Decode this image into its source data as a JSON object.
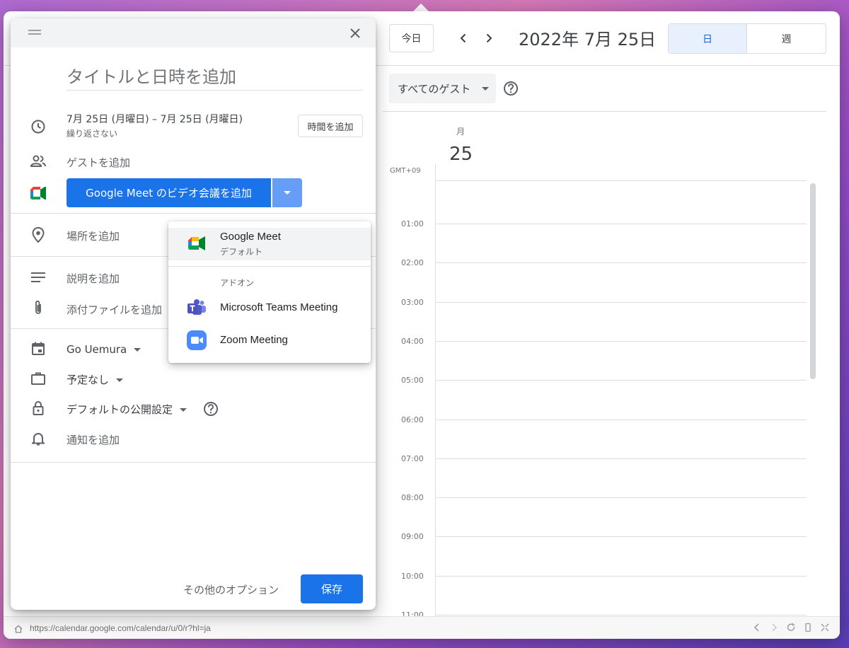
{
  "calendar": {
    "today_label": "今日",
    "date_title": "2022年 7月 25日",
    "views": {
      "day": "日",
      "week": "週"
    },
    "guest_filter": "すべてのゲスト",
    "day_name": "月",
    "day_number": "25",
    "timezone": "GMT+09",
    "hours": [
      "01:00",
      "02:00",
      "03:00",
      "04:00",
      "05:00",
      "06:00",
      "07:00",
      "08:00",
      "09:00",
      "10:00",
      "11:00"
    ]
  },
  "status_bar": {
    "url": "https://calendar.google.com/calendar/u/0/r?hl=ja"
  },
  "dialog": {
    "title_placeholder": "タイトルと日時を追加",
    "date_range": "7月 25日 (月曜日)  –  7月 25日 (月曜日)",
    "repeat": "繰り返さない",
    "add_time_label": "時間を追加",
    "add_guests": "ゲストを追加",
    "meet_button": "Google Meet のビデオ会議を追加",
    "add_location": "場所を追加",
    "add_description": "説明を追加",
    "add_attachment": "添付ファイルを追加",
    "calendar_owner": "Go Uemura",
    "busy_status": "予定なし",
    "visibility": "デフォルトの公開設定",
    "add_notification": "通知を追加",
    "more_options": "その他のオプション",
    "save": "保存"
  },
  "conference_menu": {
    "items": [
      {
        "label": "Google Meet",
        "sublabel": "デフォルト",
        "icon": "google-meet-icon"
      },
      {
        "label": "Microsoft Teams Meeting",
        "icon": "microsoft-teams-icon"
      },
      {
        "label": "Zoom Meeting",
        "icon": "zoom-icon"
      }
    ],
    "section_label": "アドオン"
  },
  "colors": {
    "primary": "#1a73e8",
    "primary_light": "#669df6",
    "selected_view_bg": "#e8f0fe",
    "selected_view_text": "#1967d2"
  }
}
